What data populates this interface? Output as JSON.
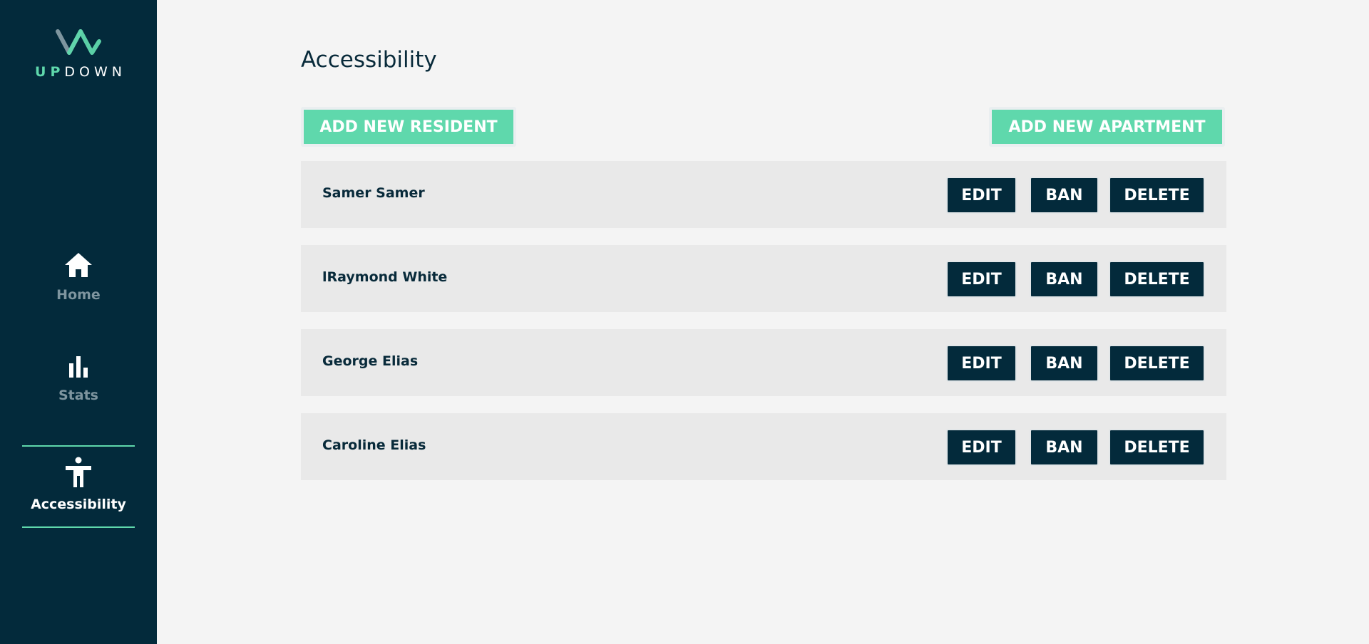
{
  "brand": {
    "name_up": "UP",
    "name_down": "DOWN",
    "accent_color": "#5fd8ac",
    "sidebar_color": "#032a3b"
  },
  "sidebar": {
    "items": [
      {
        "label": "Home",
        "icon": "home-icon",
        "active": false
      },
      {
        "label": "Stats",
        "icon": "bar-chart-icon",
        "active": false
      },
      {
        "label": "Accessibility",
        "icon": "accessibility-icon",
        "active": true
      }
    ]
  },
  "page": {
    "title": "Accessibility",
    "add_resident_label": "ADD NEW RESIDENT",
    "add_apartment_label": "ADD NEW APARTMENT"
  },
  "residents": [
    {
      "name": "Samer Samer",
      "edit": "EDIT",
      "ban": "BAN",
      "delete": "DELETE"
    },
    {
      "name": "lRaymond White",
      "edit": "EDIT",
      "ban": "BAN",
      "delete": "DELETE"
    },
    {
      "name": "George Elias",
      "edit": "EDIT",
      "ban": "BAN",
      "delete": "DELETE"
    },
    {
      "name": "Caroline Elias",
      "edit": "EDIT",
      "ban": "BAN",
      "delete": "DELETE"
    }
  ]
}
